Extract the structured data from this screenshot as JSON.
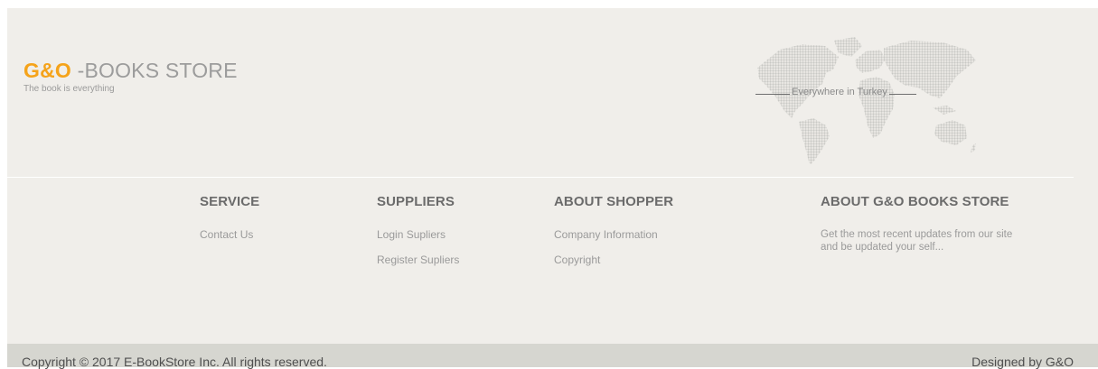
{
  "brand": {
    "accent": "G&O",
    "name": " -BOOKS STORE",
    "tagline": "The book is everything",
    "accent_color": "#f5a31a"
  },
  "map": {
    "icon": "world-map-icon",
    "caption": "Everywhere in Turkey"
  },
  "columns": [
    {
      "title": "SERVICE",
      "links": [
        "Contact Us"
      ]
    },
    {
      "title": "SUPPLIERS",
      "links": [
        "Login Supliers",
        "Register Supliers"
      ]
    },
    {
      "title": "ABOUT SHOPPER",
      "links": [
        "Company Information",
        "Copyright"
      ]
    },
    {
      "title": "ABOUT G&O BOOKS STORE",
      "text": "Get the most recent updates from our site and be updated your self..."
    }
  ],
  "bottom_bar": {
    "copyright": "Copyright © 2017 E-BookStore Inc. All rights reserved.",
    "designed_by": "Designed by G&O"
  },
  "colors": {
    "footer_background": "#f0eeea",
    "bottom_bar_background": "#d6d6d0"
  }
}
